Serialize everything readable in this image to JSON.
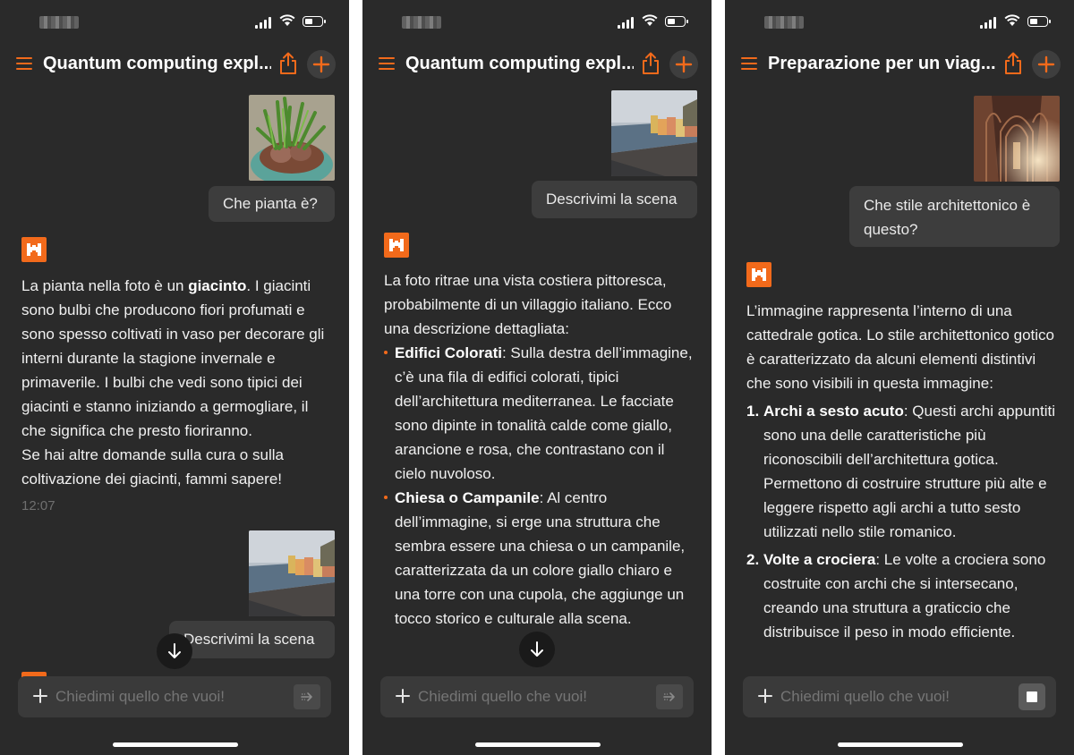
{
  "colors": {
    "accent": "#f26a1b",
    "background": "#2a2a2a",
    "bubble": "#3d3d3d"
  },
  "common": {
    "composer_placeholder": "Chiedimi quello che vuoi!"
  },
  "phones": [
    {
      "header_title": "Quantum computing expl...",
      "user_message_1": "Che pianta è?",
      "ai_message_parts": [
        "La pianta nella foto è un ",
        "giacinto",
        ". I giacinti sono bulbi che producono fiori profumati e sono spesso coltivati in vaso per decorare gli interni durante la stagione invernale e primaverile. I bulbi che vedi sono tipici dei giacinti e stanno iniziando a germogliare, il che significa che presto fioriranno."
      ],
      "ai_message_followup": "Se hai altre domande sulla cura o sulla coltivazione dei giacinti, fammi sapere!",
      "timestamp": "12:07",
      "user_message_2": "Descrivimi la scena",
      "send_icon": "send-arrow-icon"
    },
    {
      "header_title": "Quantum computing expl...",
      "user_message": "Descrivimi la scena",
      "ai_intro": "La foto ritrae una vista costiera pittoresca, probabilmente di un villaggio italiano. Ecco una descrizione dettagliata:",
      "bullets": [
        {
          "term": "Edifici Colorati",
          "text": ": Sulla destra dell’immagine, c’è una fila di edifici colorati, tipici dell’architettura mediterranea. Le facciate sono dipinte in tonalità calde come giallo, arancione e rosa, che contrastano con il cielo nuvoloso."
        },
        {
          "term": "Chiesa o Campanile",
          "text": ": Al centro dell’immagine, si erge una struttura che sembra essere una chiesa o un campanile, caratterizzata da un colore giallo chiaro e una torre con una cupola, che aggiunge un tocco storico e culturale alla scena."
        }
      ]
    },
    {
      "header_title": "Preparazione per un viag...",
      "user_message": "Che stile architettonico è questo?",
      "ai_intro": "L’immagine rappresenta l’interno di una cattedrale gotica. Lo stile architettonico gotico è caratterizzato da alcuni elementi distintivi che sono visibili in questa immagine:",
      "items": [
        {
          "n": "1.",
          "term": "Archi a sesto acuto",
          "text": ": Questi archi appuntiti sono una delle caratteristiche più riconoscibili dell’architettura gotica. Permettono di costruire strutture più alte e leggere rispetto agli archi a tutto sesto utilizzati nello stile romanico."
        },
        {
          "n": "2.",
          "term": "Volte a crociera",
          "text": ": Le volte a crociera sono costruite con archi che si intersecano, creando una struttura a graticcio che distribuisce il peso in modo efficiente."
        }
      ],
      "stop_icon": "stop-icon"
    }
  ]
}
